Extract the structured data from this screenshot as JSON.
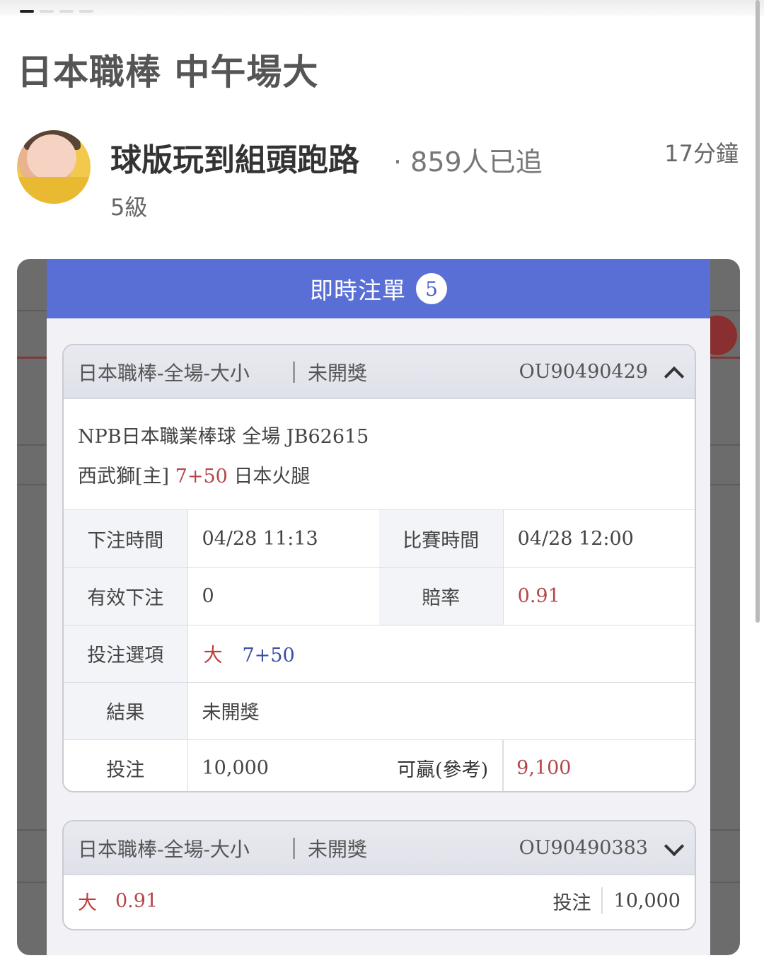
{
  "post": {
    "title": "日本職棒 中午場大"
  },
  "author": {
    "name": "球版玩到組頭跑路",
    "followers": "· 859人已追",
    "level": "5級",
    "time": "17分鐘"
  },
  "modal": {
    "title": "即時注單",
    "badge": "5"
  },
  "ticket1": {
    "category": "日本職棒-全場-大小",
    "status": "未開獎",
    "id": "OU90490429",
    "match_line": "NPB日本職業棒球 全場 JB62615",
    "home": "西武獅[主]",
    "line": "7+50",
    "away": "日本火腿",
    "bet_time_label": "下注時間",
    "bet_time": "04/28 11:13",
    "match_time_label": "比賽時間",
    "match_time": "04/28 12:00",
    "valid_label": "有效下注",
    "valid": "0",
    "odds_label": "賠率",
    "odds": "0.91",
    "option_label": "投注選項",
    "option_side": "大",
    "option_line": "7+50",
    "result_label": "結果",
    "result": "未開獎",
    "stake_label": "投注",
    "stake": "10,000",
    "win_label": "可贏(參考)",
    "win": "9,100"
  },
  "ticket2": {
    "category": "日本職棒-全場-大小",
    "status": "未開獎",
    "id": "OU90490383",
    "side": "大",
    "odds": "0.91",
    "stake_label": "投注",
    "stake": "10,000"
  }
}
